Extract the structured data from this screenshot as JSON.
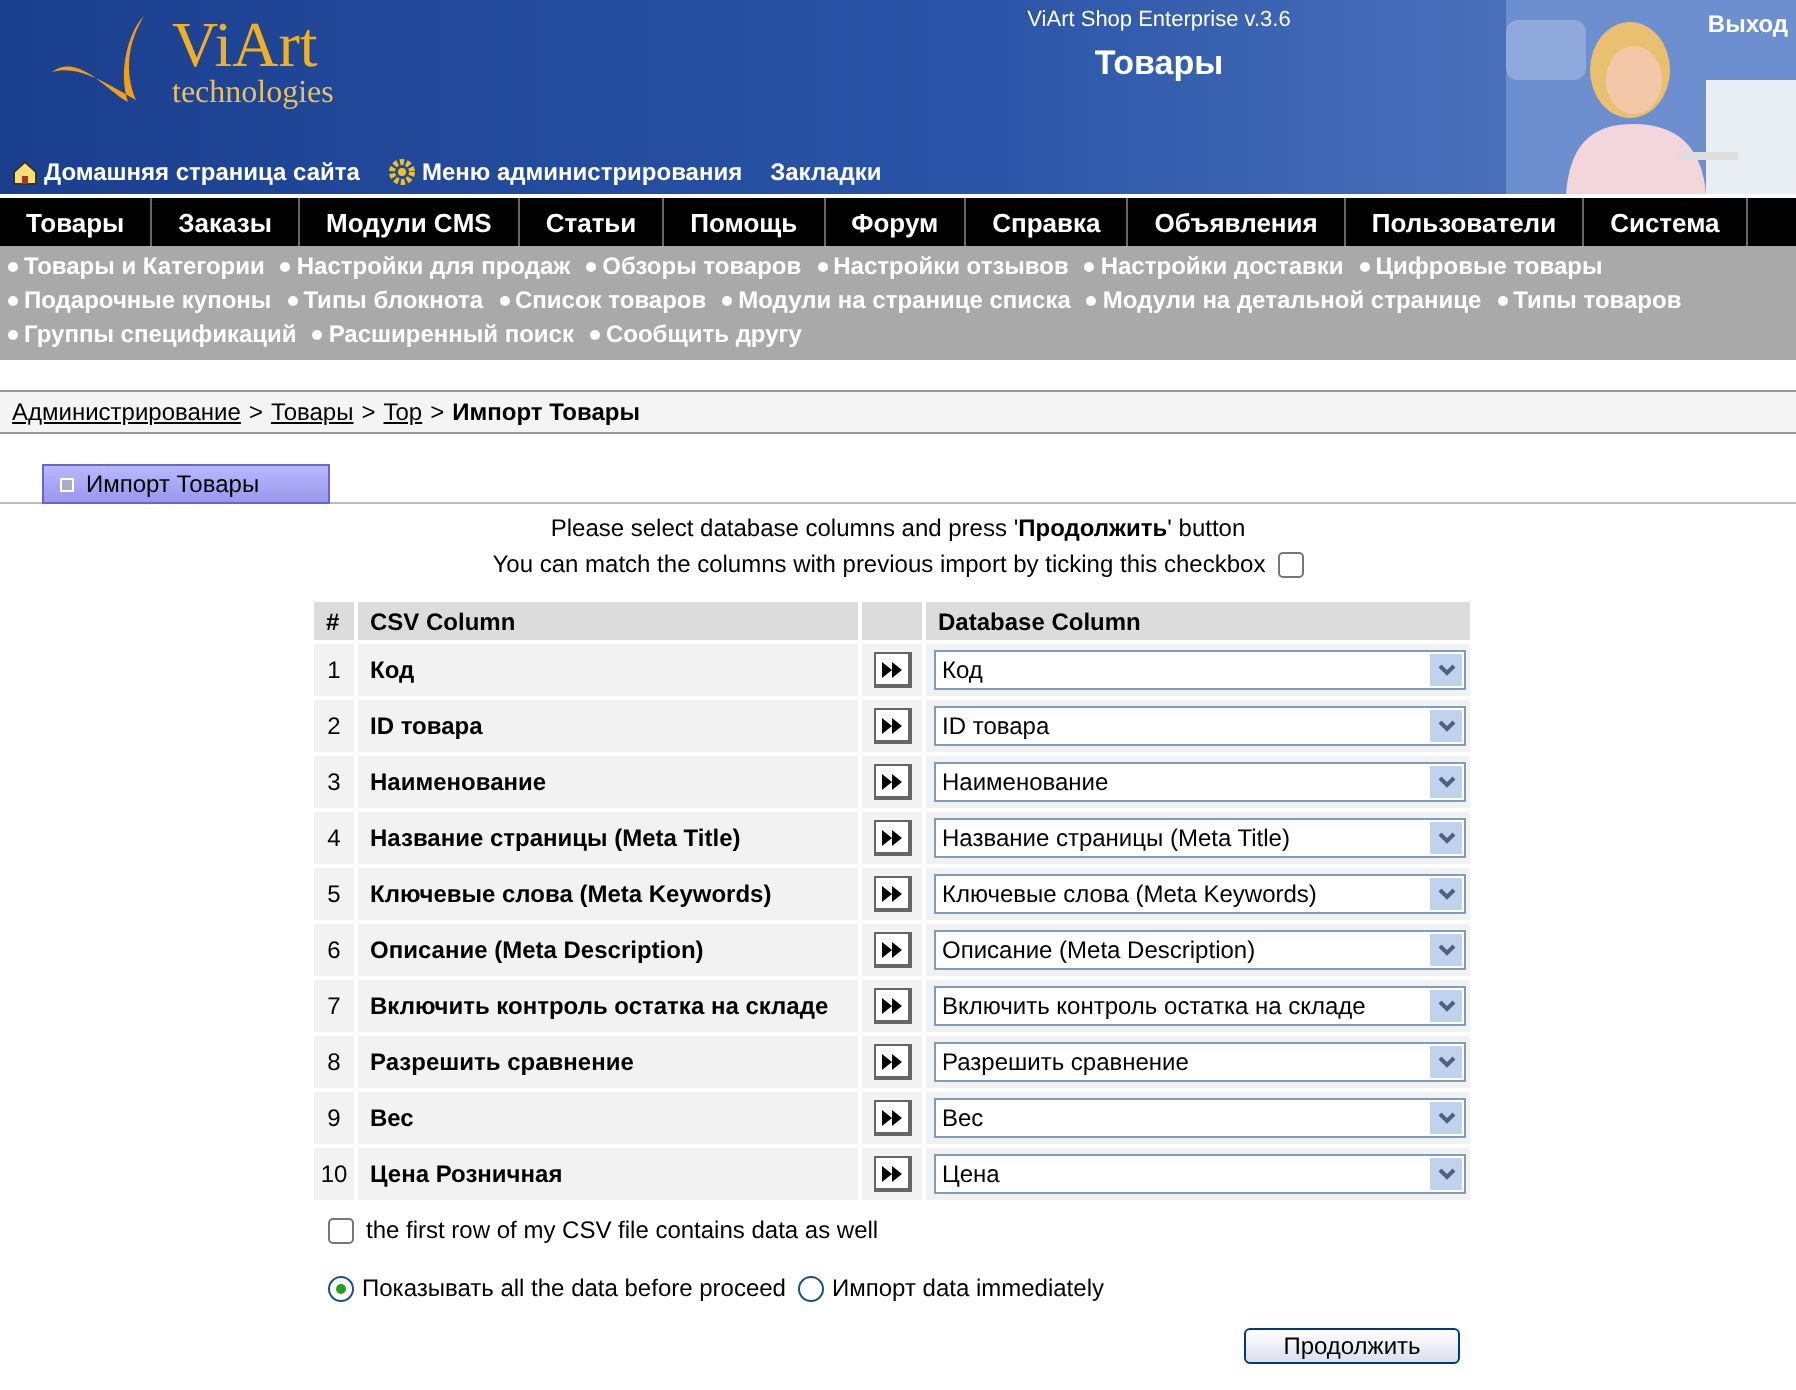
{
  "header": {
    "logo": {
      "name": "ViArt",
      "tagline": "technologies"
    },
    "product": "ViArt Shop Enterprise v.3.6",
    "title": "Товары",
    "logout": "Выход",
    "links": [
      {
        "kind": "home",
        "label": "Домашняя страница сайта"
      },
      {
        "kind": "gear",
        "label": "Меню администрирования"
      },
      {
        "kind": "plain",
        "label": "Закладки"
      }
    ]
  },
  "nav": [
    "Товары",
    "Заказы",
    "Модули CMS",
    "Статьи",
    "Помощь",
    "Форум",
    "Справка",
    "Объявления",
    "Пользователи",
    "Система"
  ],
  "submenu": [
    "Товары и Категории",
    "Настройки для продаж",
    "Обзоры товаров",
    "Настройки отзывов",
    "Настройки доставки",
    "Цифровые товары",
    "Подарочные купоны",
    "Типы блокнота",
    "Список товаров",
    "Модули на странице списка",
    "Модули на детальной странице",
    "Типы товаров",
    "Группы спецификаций",
    "Расширенный поиск",
    "Сообщить другу"
  ],
  "breadcrumb": {
    "links": [
      "Администрирование",
      "Товары",
      "Top"
    ],
    "separator": ">",
    "current": "Импорт Товары"
  },
  "section_tab": "Импорт Товары",
  "intro": "Please select database columns and press '**Продолжить**' button",
  "match_previous": {
    "label": "You can match the columns with previous import by ticking this checkbox",
    "checked": false
  },
  "table": {
    "columns": [
      "#",
      "CSV Column",
      "Database Column"
    ],
    "rows": [
      {
        "num": "1",
        "csv": "Код",
        "db": "Код"
      },
      {
        "num": "2",
        "csv": "ID товара",
        "db": "ID товара"
      },
      {
        "num": "3",
        "csv": "Наименование",
        "db": "Наименование"
      },
      {
        "num": "4",
        "csv": "Название страницы (Meta Title)",
        "db": "Название страницы (Meta Title)"
      },
      {
        "num": "5",
        "csv": "Ключевые слова (Meta Keywords)",
        "db": "Ключевые слова (Meta Keywords)"
      },
      {
        "num": "6",
        "csv": "Описание (Meta Description)",
        "db": "Описание (Meta Description)"
      },
      {
        "num": "7",
        "csv": "Включить контроль остатка на складе",
        "db": "Включить контроль остатка на складе"
      },
      {
        "num": "8",
        "csv": "Разрешить сравнение",
        "db": "Разрешить сравнение"
      },
      {
        "num": "9",
        "csv": "Вес",
        "db": "Вес"
      },
      {
        "num": "10",
        "csv": "Цена Розничная",
        "db": "Цена"
      }
    ]
  },
  "first_row": {
    "label": "the first row of my CSV file contains data as well",
    "checked": false
  },
  "mode": [
    {
      "label": "Показывать all the data before proceed",
      "selected": true
    },
    {
      "label": "Импорт data immediately",
      "selected": false
    }
  ],
  "submit": "Продолжить"
}
